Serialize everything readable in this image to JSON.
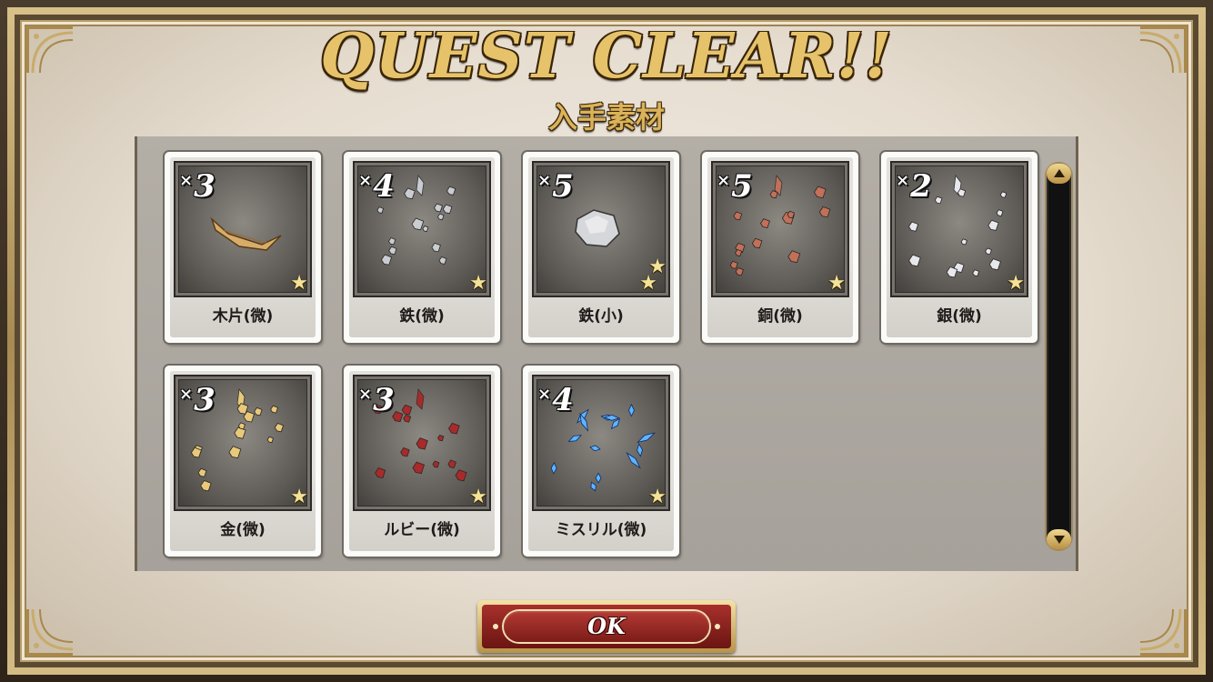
{
  "header": {
    "title": "QUEST CLEAR!!",
    "subtitle": "入手素材"
  },
  "qty_prefix": "×",
  "items": [
    {
      "name": "木片(微)",
      "quantity": "3",
      "stars": 1,
      "icon": "wood-chip-icon",
      "color": "#d8ad6a"
    },
    {
      "name": "鉄(微)",
      "quantity": "4",
      "stars": 1,
      "icon": "iron-fragments-icon",
      "color": "#c9ccd1"
    },
    {
      "name": "鉄(小)",
      "quantity": "5",
      "stars": 2,
      "icon": "iron-chunk-icon",
      "color": "#d6d7da"
    },
    {
      "name": "銅(微)",
      "quantity": "5",
      "stars": 1,
      "icon": "copper-fragments-icon",
      "color": "#c2705a"
    },
    {
      "name": "銀(微)",
      "quantity": "2",
      "stars": 1,
      "icon": "silver-fragments-icon",
      "color": "#e6e8ee"
    },
    {
      "name": "金(微)",
      "quantity": "3",
      "stars": 1,
      "icon": "gold-fragments-icon",
      "color": "#e8c97a"
    },
    {
      "name": "ルビー(微)",
      "quantity": "3",
      "stars": 1,
      "icon": "ruby-fragments-icon",
      "color": "#a92a2a"
    },
    {
      "name": "ミスリル(微)",
      "quantity": "4",
      "stars": 1,
      "icon": "mithril-shards-icon",
      "color": "#5fb4ff"
    }
  ],
  "ok_button": {
    "label": "OK"
  },
  "colors": {
    "title_gold": "#e6c36a",
    "ok_red": "#a8302c",
    "parchment": "#ece5da"
  }
}
